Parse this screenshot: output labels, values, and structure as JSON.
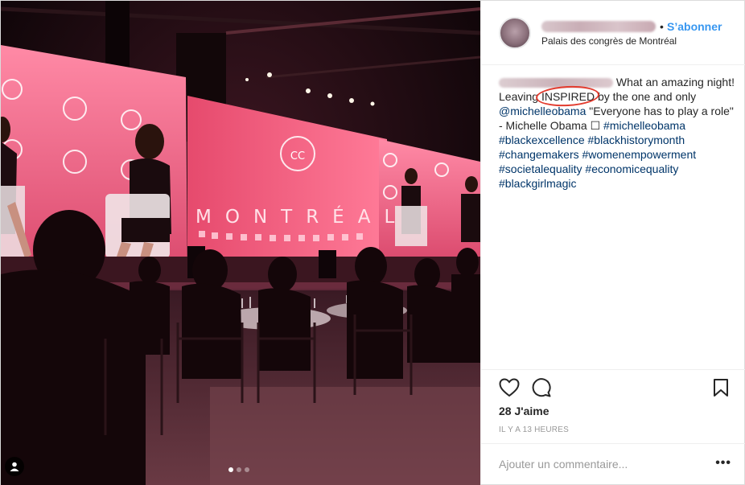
{
  "post": {
    "user": {
      "username": "",
      "follow_label": "S’abonner",
      "separator": "•",
      "location": "Palais des congrès de Montréal"
    },
    "caption": {
      "text_1": "What an amazing night! Leaving ",
      "highlight": "INSPIRED",
      "text_2": " by the one and only ",
      "mention": "@michelleobama",
      "text_3": " \"Everyone has to play a role\" - Michelle Obama ☐ ",
      "hashtags": [
        "#michelleobama",
        "#blackexcellence",
        "#blackhistorymonth",
        "#changemakers",
        "#womenempowerment",
        "#societalequality",
        "#economicequality",
        "#blackgirlmagic"
      ]
    },
    "photo": {
      "screen_text": "MONTRÉAL",
      "logo_text": "CC",
      "carousel_index": 1,
      "carousel_count": 3
    },
    "actions": {
      "like_icon": "heart-icon",
      "comment_icon": "comment-bubble-icon",
      "save_icon": "bookmark-icon",
      "likes_label": "28 J'aime",
      "timestamp": "IL Y A 13 HEURES"
    },
    "comment": {
      "placeholder": "Ajouter un commentaire...",
      "more_label": "•••"
    }
  }
}
